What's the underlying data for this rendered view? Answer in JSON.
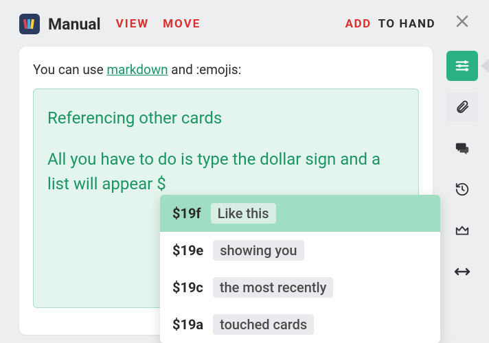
{
  "header": {
    "title": "Manual",
    "view": "VIEW",
    "move": "MOVE",
    "add": "ADD",
    "to_hand": "TO HAND"
  },
  "info": {
    "prefix": "You can use ",
    "markdown": "markdown",
    "suffix": " and :emojis:"
  },
  "editor": {
    "title": "Referencing other cards",
    "body": "All you have to do is type the dollar sign and a list will appear $"
  },
  "suggestions": [
    {
      "id": "$19f",
      "label": "Like this",
      "selected": true
    },
    {
      "id": "$19e",
      "label": "showing you",
      "selected": false
    },
    {
      "id": "$19c",
      "label": "the most recently",
      "selected": false
    },
    {
      "id": "$19a",
      "label": "touched cards",
      "selected": false
    }
  ],
  "sidebar": {
    "items": [
      {
        "name": "settings-sliders-icon",
        "active": true
      },
      {
        "name": "paperclip-icon",
        "active": false
      },
      {
        "name": "comments-icon",
        "active": false
      },
      {
        "name": "history-icon",
        "active": false
      },
      {
        "name": "crown-icon",
        "active": false
      },
      {
        "name": "resize-horizontal-icon",
        "active": false
      }
    ]
  }
}
